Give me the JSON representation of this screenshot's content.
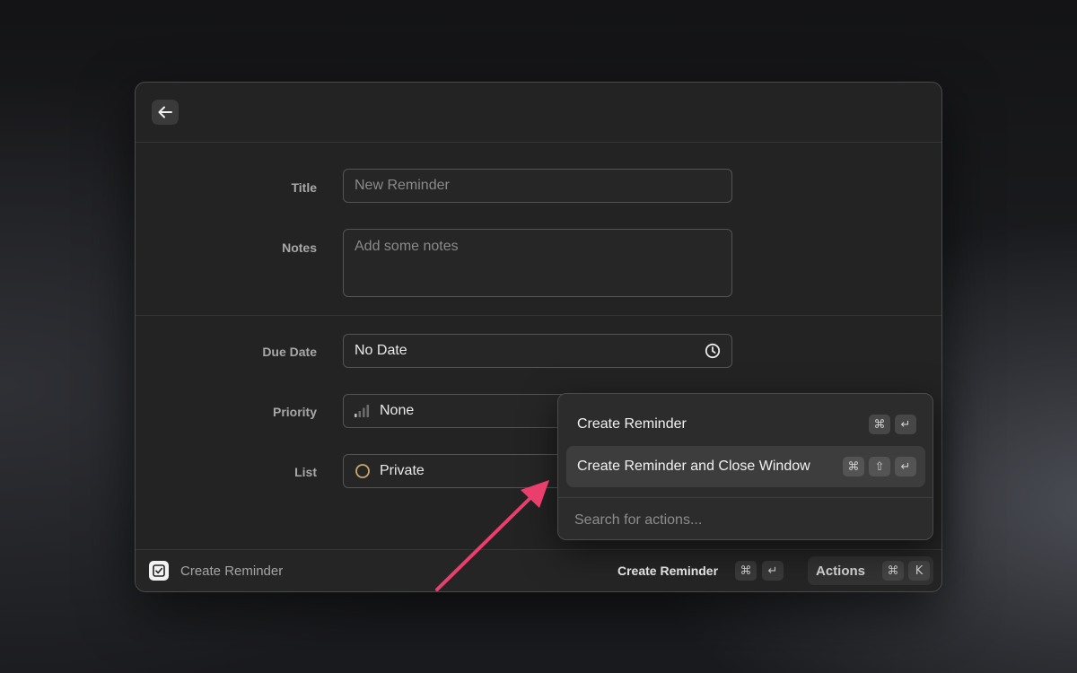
{
  "form": {
    "title": {
      "label": "Title",
      "placeholder": "New Reminder"
    },
    "notes": {
      "label": "Notes",
      "placeholder": "Add some notes"
    },
    "due_date": {
      "label": "Due Date",
      "value": "No Date",
      "icon": "clock-icon"
    },
    "priority": {
      "label": "Priority",
      "value": "None",
      "icon": "signal-bars-icon"
    },
    "list": {
      "label": "List",
      "value": "Private",
      "icon": "circle-icon",
      "color": "#c9a96a"
    }
  },
  "footer": {
    "app_title": "Create Reminder",
    "primary_action": "Create Reminder",
    "primary_keys": [
      "⌘",
      "↵"
    ],
    "actions_label": "Actions",
    "actions_keys": [
      "⌘",
      "K"
    ]
  },
  "actions_menu": {
    "items": [
      {
        "label": "Create Reminder",
        "keys": [
          "⌘",
          "↵"
        ],
        "selected": false
      },
      {
        "label": "Create Reminder and Close Window",
        "keys": [
          "⌘",
          "⇧",
          "↵"
        ],
        "selected": true
      }
    ],
    "search_placeholder": "Search for actions..."
  },
  "colors": {
    "accent_arrow": "#ea3f6c",
    "window_bg": "#232323"
  }
}
